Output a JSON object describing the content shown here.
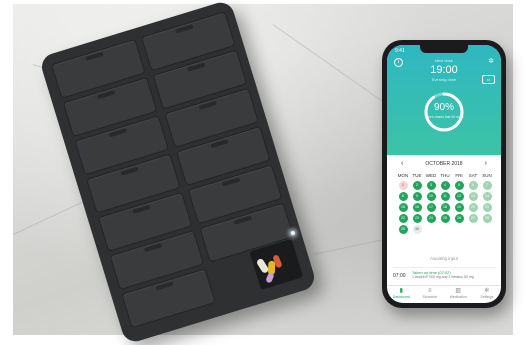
{
  "app": {
    "status_time": "9:41",
    "header": {
      "next_dose_label": "Next dose",
      "dose_time": "19:00",
      "dose_sub": "Evening dose",
      "adherence_percent": "90%",
      "adherence_fraction": 0.9,
      "adherence_sub": "Taken doses last 30 days"
    },
    "calendar": {
      "month_label": "OCTOBER 2018",
      "prev_icon": "‹",
      "next_icon": "›",
      "weekdays": [
        "MON",
        "TUE",
        "WED",
        "THU",
        "FRI",
        "SAT",
        "SUN"
      ],
      "rows": [
        [
          {
            "d": "1",
            "s": "red"
          },
          {
            "d": "2",
            "s": "green"
          },
          {
            "d": "3",
            "s": "green"
          },
          {
            "d": "4",
            "s": "green"
          },
          {
            "d": "5",
            "s": "green"
          },
          {
            "d": "6",
            "s": "light"
          },
          {
            "d": "7",
            "s": "light"
          }
        ],
        [
          {
            "d": "8",
            "s": "green"
          },
          {
            "d": "9",
            "s": "green"
          },
          {
            "d": "10",
            "s": "green"
          },
          {
            "d": "11",
            "s": "green"
          },
          {
            "d": "12",
            "s": "green"
          },
          {
            "d": "13",
            "s": "light"
          },
          {
            "d": "14",
            "s": "light"
          }
        ],
        [
          {
            "d": "15",
            "s": "green"
          },
          {
            "d": "16",
            "s": "green"
          },
          {
            "d": "17",
            "s": "green"
          },
          {
            "d": "18",
            "s": "green"
          },
          {
            "d": "19",
            "s": "green"
          },
          {
            "d": "20",
            "s": "light"
          },
          {
            "d": "21",
            "s": "light"
          }
        ],
        [
          {
            "d": "22",
            "s": "green"
          },
          {
            "d": "23",
            "s": "green"
          },
          {
            "d": "24",
            "s": "green"
          },
          {
            "d": "25",
            "s": "green"
          },
          {
            "d": "26",
            "s": "green"
          },
          {
            "d": "27",
            "s": "light"
          },
          {
            "d": "28",
            "s": "light"
          }
        ],
        [
          {
            "d": "29",
            "s": "green"
          },
          {
            "d": "30",
            "s": "today"
          },
          {
            "d": "",
            "s": "empty"
          },
          {
            "d": "",
            "s": "empty"
          },
          {
            "d": "",
            "s": "empty"
          },
          {
            "d": "",
            "s": "empty"
          },
          {
            "d": "",
            "s": "empty"
          }
        ]
      ]
    },
    "upcoming_label": "Awaiting input",
    "dose_entry": {
      "time": "07:00",
      "title": "Taken on time (07:02)",
      "desc": "1 Aspirin® 500 mg and 2 Betaloc 50 mg"
    },
    "tabs": [
      {
        "label": "Dashboard",
        "icon": "chart-icon",
        "glyph": "▮"
      },
      {
        "label": "Schedule",
        "icon": "list-icon",
        "glyph": "≡"
      },
      {
        "label": "Medication",
        "icon": "pill-icon",
        "glyph": "▥"
      },
      {
        "label": "Settings",
        "icon": "gear-icon",
        "glyph": "✲"
      }
    ]
  },
  "colors": {
    "accent_green": "#22a45a",
    "header_teal": "#2fb7c2",
    "organizer_body": "#2f3032"
  }
}
